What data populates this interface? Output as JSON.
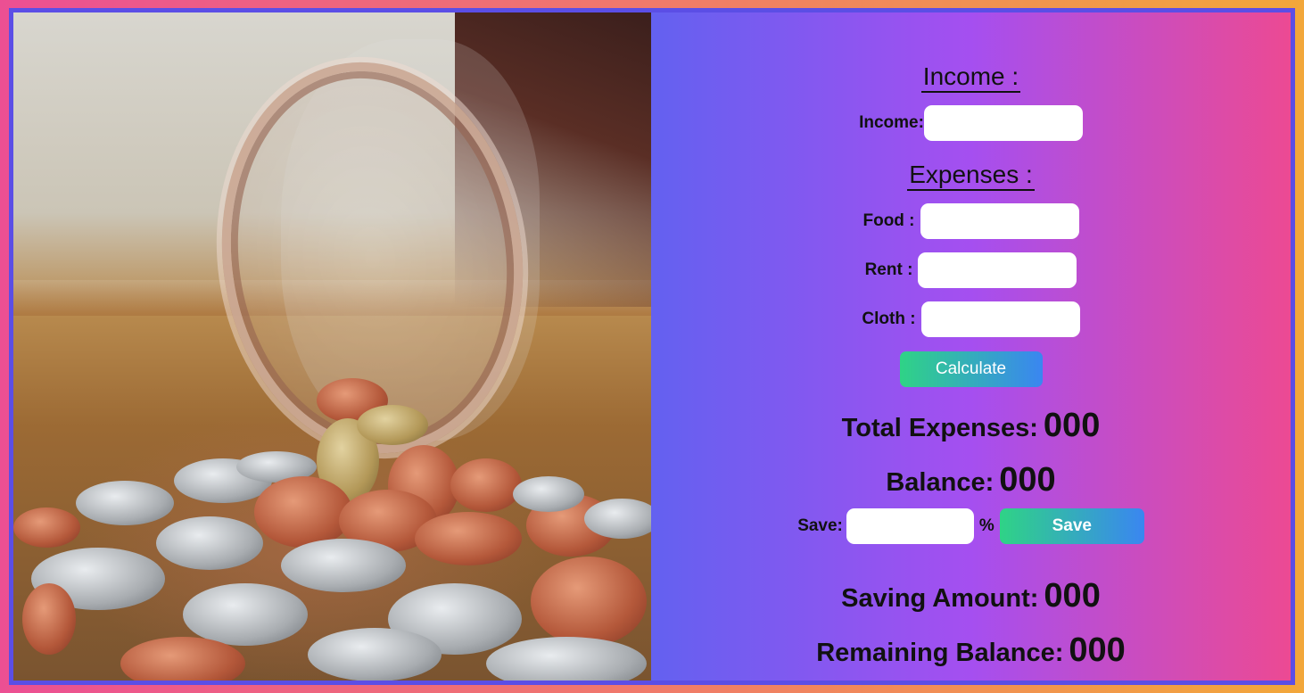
{
  "income_section": {
    "heading": "Income :",
    "income_label": "Income:",
    "income_value": ""
  },
  "expenses_section": {
    "heading": "Expenses :",
    "food_label": "Food :",
    "food_value": "",
    "rent_label": "Rent :",
    "rent_value": "",
    "cloth_label": "Cloth :",
    "cloth_value": ""
  },
  "calculate_button": "Calculate",
  "total_expenses": {
    "label": "Total Expenses:",
    "value": "000"
  },
  "balance": {
    "label": "Balance:",
    "value": "000"
  },
  "save_section": {
    "label": "Save:",
    "value": "",
    "percent_sign": "%",
    "button": "Save"
  },
  "saving_amount": {
    "label": "Saving Amount:",
    "value": "000"
  },
  "remaining_balance": {
    "label": "Remaining Balance:",
    "value": "000"
  },
  "colors": {
    "frame_border": "#5b4ee6",
    "panel_gradient_start": "#6361f0",
    "panel_gradient_end": "#ec4a93",
    "button_gradient_start": "#2fd386",
    "button_gradient_end": "#3a86f1"
  }
}
